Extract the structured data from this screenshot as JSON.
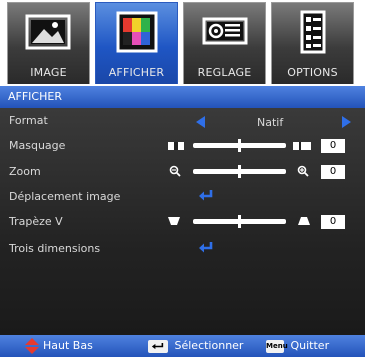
{
  "tabs": [
    {
      "label": "IMAGE",
      "icon": "picture-icon",
      "active": false
    },
    {
      "label": "AFFICHER",
      "icon": "display-icon",
      "active": true
    },
    {
      "label": "REGLAGE",
      "icon": "projector-icon",
      "active": false
    },
    {
      "label": "OPTIONS",
      "icon": "options-icon",
      "active": false
    }
  ],
  "header": {
    "title": "AFFICHER"
  },
  "menu": {
    "format": {
      "label": "Format",
      "value": "Natif"
    },
    "masquage": {
      "label": "Masquage",
      "value": "0",
      "level": 0.5
    },
    "zoom": {
      "label": "Zoom",
      "value": "0",
      "level": 0.5
    },
    "deplacement": {
      "label": "Déplacement image"
    },
    "trapeze": {
      "label": "Trapèze V",
      "value": "0",
      "level": 0.5
    },
    "trois": {
      "label": "Trois dimensions"
    }
  },
  "footer": {
    "nav_label": "Haut Bas",
    "select_label": "Sélectionner",
    "menu_key": "Menu",
    "quit_label": "Quitter"
  },
  "colors": {
    "accent": "#2a5fd0",
    "arrow": "#2f6fe8",
    "panel": "#262626"
  }
}
